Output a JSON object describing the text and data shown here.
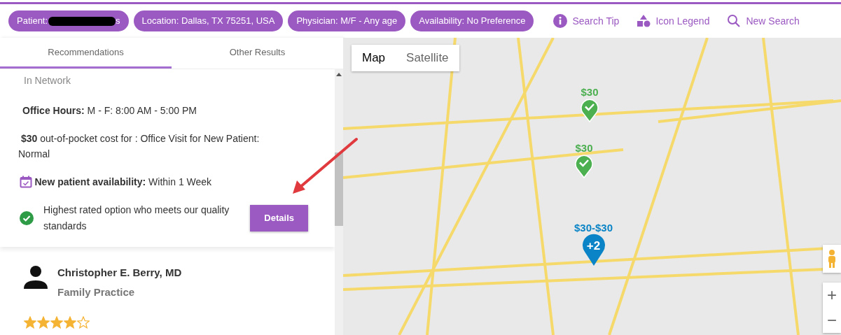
{
  "filters": [
    {
      "label": "Patient:",
      "redacted": true,
      "trailing": "s"
    },
    {
      "label": "Location: Dallas, TX 75251, USA",
      "redacted": false
    },
    {
      "label": "Physician: M/F - Any age",
      "redacted": false
    },
    {
      "label": "Availability: No Preference",
      "redacted": false
    }
  ],
  "links": [
    {
      "kind": "info",
      "label": "Search Tip"
    },
    {
      "kind": "legend",
      "label": "Icon Legend"
    },
    {
      "kind": "search",
      "label": "New Search"
    }
  ],
  "tabs": [
    {
      "label": "Recommendations",
      "selected": true
    },
    {
      "label": "Other Results",
      "selected": false
    }
  ],
  "current_result": {
    "network": "In Network",
    "hours_label": "Office Hours:",
    "hours": "M - F: 8:00 AM - 5:00 PM",
    "cost_amount": "$30",
    "cost_text": "out-of-pocket cost for : Office Visit for New Patient: Normal",
    "availability_label": "New patient availability:",
    "availability": "Within 1 Week",
    "quality_note": "Highest rated option who meets our quality standards",
    "details_button": "Details"
  },
  "next_result": {
    "name": "Christopher E. Berry, MD",
    "specialty": "Family Practice",
    "stars": 4
  },
  "map": {
    "map_types": [
      {
        "label": "Map",
        "selected": true
      },
      {
        "label": "Satellite",
        "selected": false
      }
    ],
    "markers": [
      {
        "kind": "check",
        "price": "$30",
        "color": "#4caf50"
      },
      {
        "kind": "check",
        "price": "$30",
        "color": "#4caf50"
      },
      {
        "kind": "cluster",
        "price": "$30-$30",
        "count": "+2",
        "color": "#0a84c6"
      }
    ],
    "zoom_in": "+",
    "zoom_out": "−"
  },
  "annotation_arrow": true
}
